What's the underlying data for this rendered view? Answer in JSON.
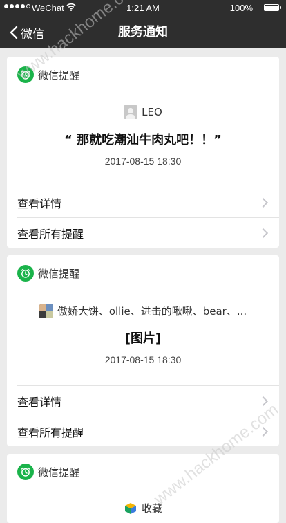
{
  "status_bar": {
    "carrier": "WeChat",
    "time": "1:21 AM",
    "battery": "100%"
  },
  "nav": {
    "back_label": "微信",
    "title": "服务通知"
  },
  "cards": [
    {
      "header": "微信提醒",
      "sender": "LEO",
      "title": "“ 那就吃潮汕牛肉丸吧！！”",
      "time": "2017-08-15 18:30",
      "links": [
        "查看详情",
        "查看所有提醒"
      ]
    },
    {
      "header": "微信提醒",
      "sender": "傲娇大饼、ollie、进击的啾啾、bear、...",
      "title": "[图片]",
      "time": "2017-08-15 18:30",
      "links": [
        "查看详情",
        "查看所有提醒"
      ]
    },
    {
      "header": "微信提醒",
      "sender": "收藏"
    }
  ],
  "watermark": "www.hackhome.com",
  "colors": {
    "nav_bg": "#2e2e2e",
    "page_bg": "#ebebeb",
    "accent_green": "#1ab34a"
  }
}
